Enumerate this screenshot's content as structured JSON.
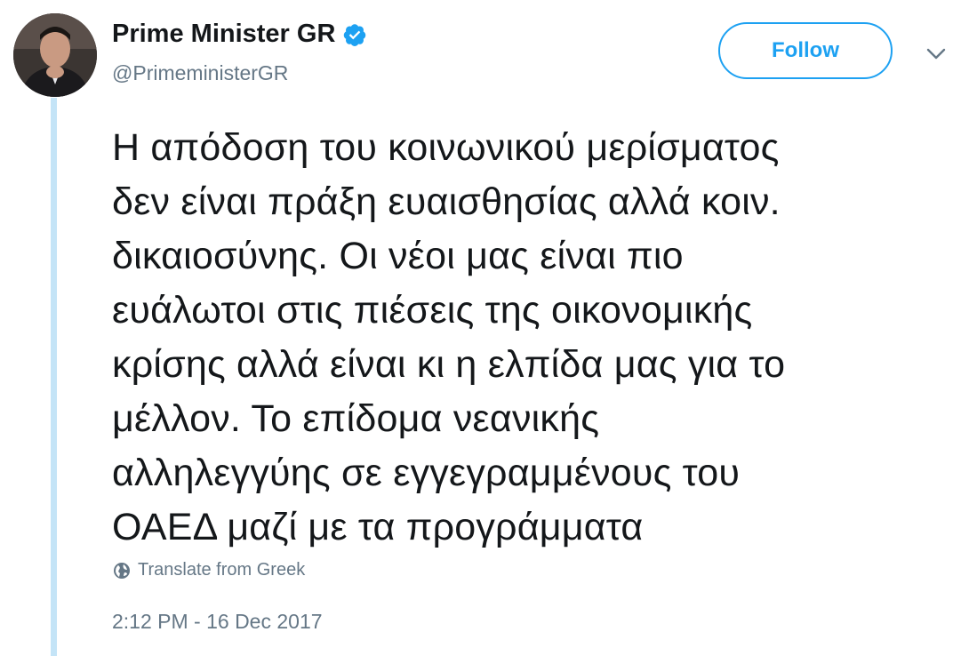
{
  "colors": {
    "accent": "#1da1f2",
    "text_primary": "#14171a",
    "text_secondary": "#657786",
    "thread_line": "#c4e4f7"
  },
  "author": {
    "name": "Prime Minister GR",
    "handle": "@PrimeministerGR",
    "verified": true,
    "verified_icon": "verified-badge-icon"
  },
  "actions": {
    "follow_label": "Follow",
    "more_icon": "chevron-down-icon"
  },
  "tweet": {
    "lines": [
      "Η απόδοση του κοινωνικού μερίσματος",
      "δεν είναι πράξη ευαισθησίας αλλά κοιν.",
      "δικαιοσύνης. Οι νέοι μας είναι πιο",
      "ευάλωτοι στις πιέσεις της οικονομικής",
      "κρίσης αλλά είναι κι η ελπίδα μας για το",
      "μέλλον. Το επίδομα νεανικής",
      "αλληλεγγύης σε εγγεγραμμένους του",
      "ΟΑΕΔ μαζί με τα προγράμματα"
    ],
    "translate_label": "Translate from Greek",
    "translate_icon": "globe-icon",
    "timestamp": "2:12 PM - 16 Dec 2017"
  }
}
